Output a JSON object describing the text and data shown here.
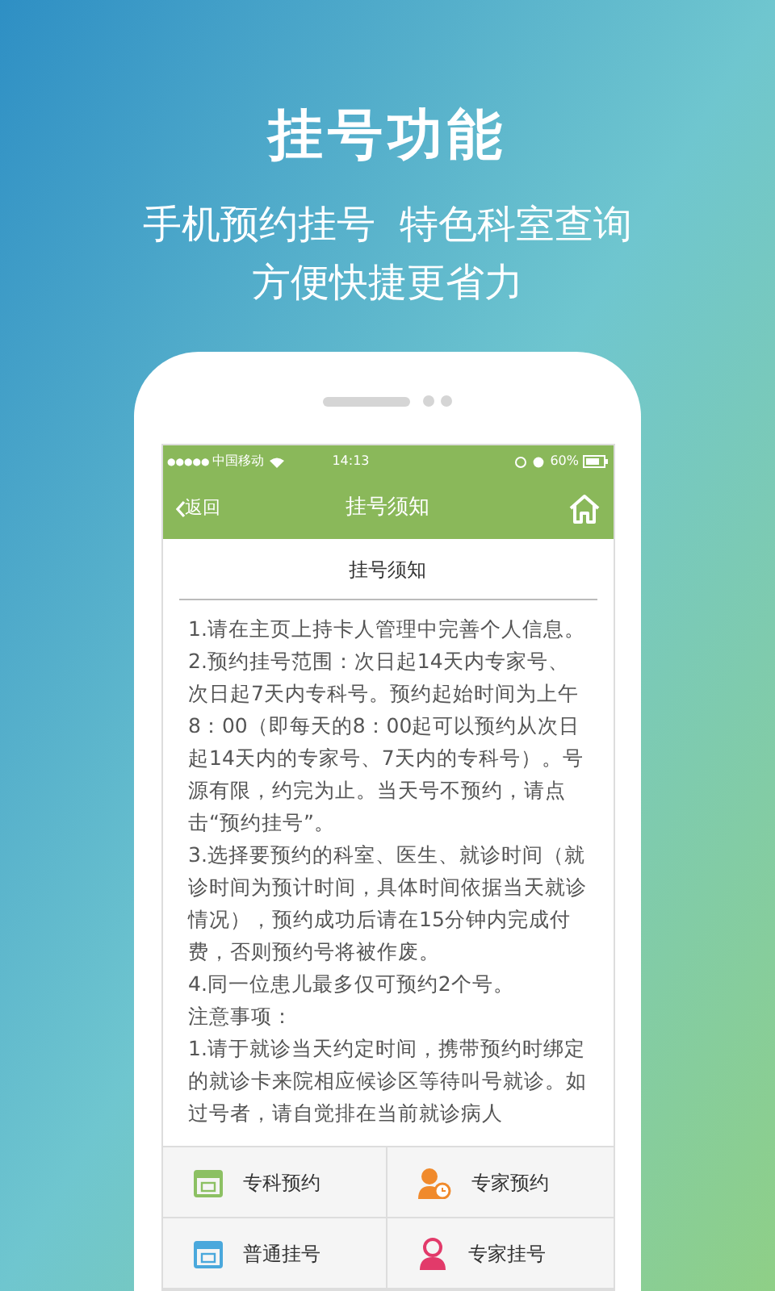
{
  "promo": {
    "title": "挂号功能",
    "subtitle_lines": [
      "手机预约挂号  特色科室查询",
      "方便快捷更省力"
    ]
  },
  "status_bar": {
    "signal": "●●●●●",
    "carrier": "中国移动",
    "time": "14:13",
    "battery": "60%"
  },
  "nav_bar": {
    "back": "返回",
    "title": "挂号须知"
  },
  "notice": {
    "heading": "挂号须知",
    "paragraphs": [
      "1.请在主页上持卡人管理中完善个人信息。",
      "2.预约挂号范围：次日起14天内专家号、次日起7天内专科号。预约起始时间为上午8：00（即每天的8：00起可以预约从次日起14天内的专家号、7天内的专科号）。号源有限，约完为止。当天号不预约，请点击“预约挂号”。",
      "3.选择要预约的科室、医生、就诊时间（就诊时间为预计时间，具体时间依据当天就诊情况），预约成功后请在15分钟内完成付费，否则预约号将被作废。",
      "4.同一位患儿最多仅可预约2个号。",
      "注意事项：",
      "1.请于就诊当天约定时间，携带预约时绑定的就诊卡来院相应候诊区等待叫号就诊。如过号者，请自觉排在当前就诊病人"
    ]
  },
  "menu": [
    {
      "label": "专科预约",
      "kind": "calendar",
      "color": "#8cc063"
    },
    {
      "label": "专家预约",
      "kind": "doctor-clock",
      "color": "#f08a2c"
    },
    {
      "label": "普通挂号",
      "kind": "calendar",
      "color": "#4aa8dc"
    },
    {
      "label": "专家挂号",
      "kind": "doctor",
      "color": "#e23a6a"
    }
  ]
}
